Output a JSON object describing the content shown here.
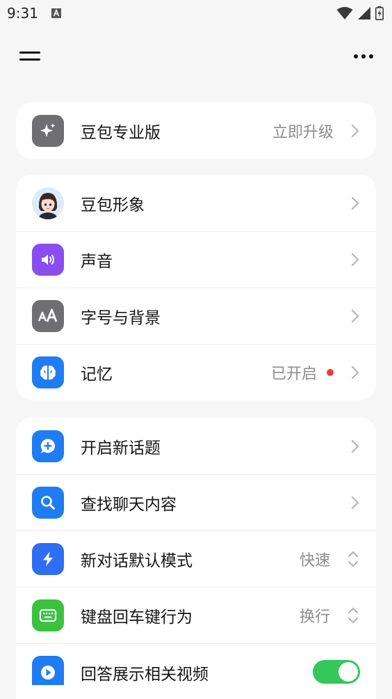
{
  "status_bar": {
    "time": "9:31"
  },
  "pro_card": {
    "label": "豆包专业版",
    "value": "立即升级"
  },
  "settings": {
    "avatar": {
      "label": "豆包形象"
    },
    "sound": {
      "label": "声音"
    },
    "font_bg": {
      "label": "字号与背景"
    },
    "memory": {
      "label": "记忆",
      "value": "已开启"
    }
  },
  "chat": {
    "new_topic": {
      "label": "开启新话题"
    },
    "search": {
      "label": "查找聊天内容"
    },
    "default_mode": {
      "label": "新对话默认模式",
      "value": "快速"
    },
    "enter_key": {
      "label": "键盘回车键行为",
      "value": "换行"
    },
    "related_video": {
      "label": "回答展示相关视频",
      "enabled": true
    }
  },
  "colors": {
    "toggle_on": "#34c759",
    "notification_dot": "#ef3b3b",
    "blue_icon": "#1f7cf2",
    "purple_icon": "#8a4df0",
    "green_icon": "#3ac23f",
    "gray_icon": "#6f6f73"
  },
  "icons": [
    "menu-icon",
    "more-icon",
    "sparkle-icon",
    "avatar-icon",
    "speaker-icon",
    "font-size-icon",
    "brain-icon",
    "chat-plus-icon",
    "search-icon",
    "lightning-icon",
    "keyboard-icon",
    "play-icon",
    "chevron-right-icon",
    "updown-icon"
  ]
}
